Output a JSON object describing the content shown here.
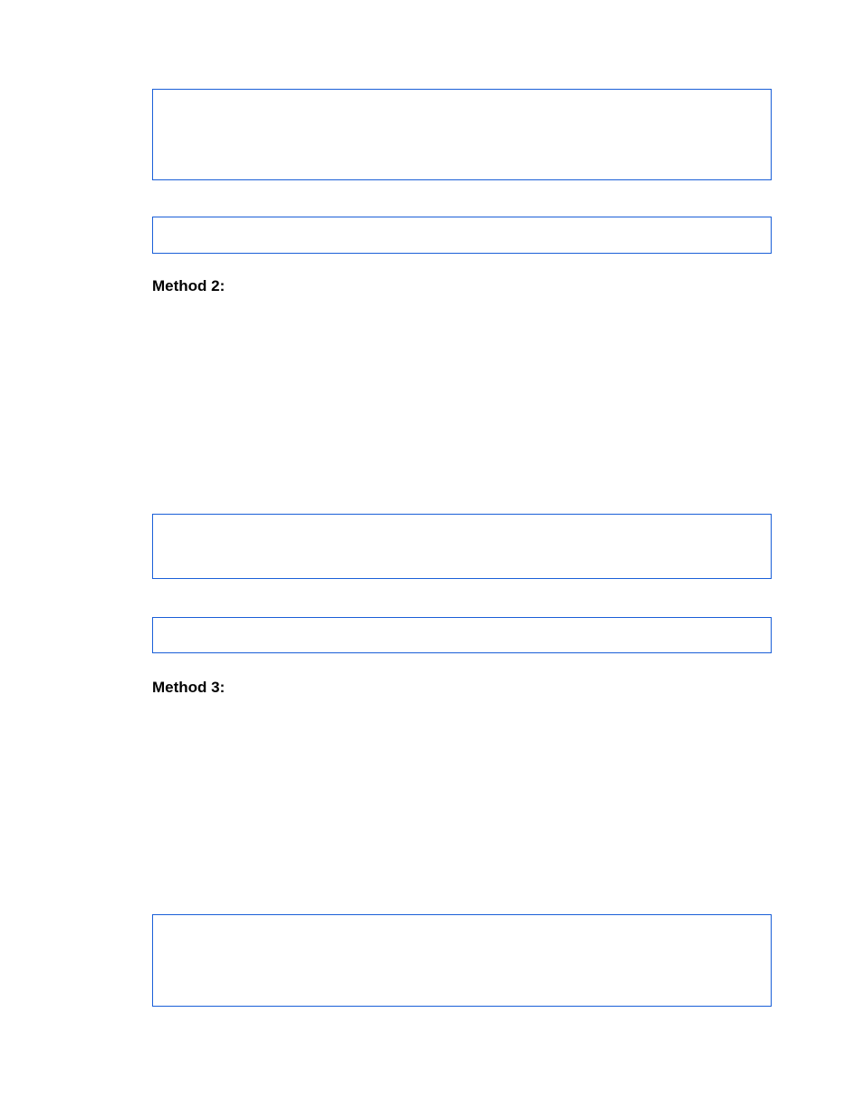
{
  "headings": {
    "method2": "Method 2:",
    "method3": "Method 3:"
  }
}
